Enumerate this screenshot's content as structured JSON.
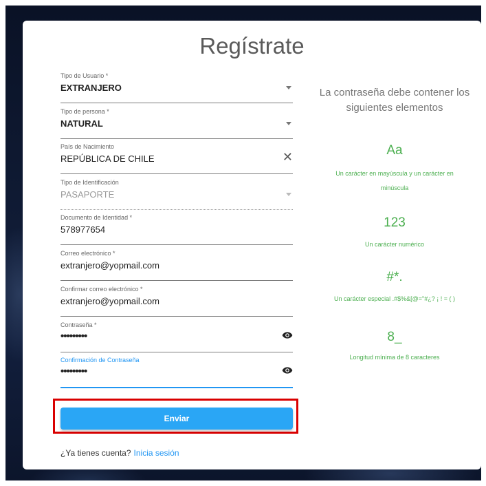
{
  "form": {
    "title": "Regístrate",
    "fields": [
      {
        "label": "Tipo de Usuario *",
        "value": "EXTRANJERO"
      },
      {
        "label": "Tipo de persona *",
        "value": "NATURAL"
      },
      {
        "label": "País de Nacimiento",
        "value": "REPÚBLICA DE CHILE"
      },
      {
        "label": "Tipo de Identificación",
        "value": "PASAPORTE"
      },
      {
        "label": "Documento de Identidad *",
        "value": "578977654"
      },
      {
        "label": "Correo electrónico *",
        "value": "extranjero@yopmail.com"
      },
      {
        "label": "Confirmar correo electrónico *",
        "value": "extranjero@yopmail.com"
      },
      {
        "label": "Contraseña *",
        "value": "•••••••••"
      },
      {
        "label": "Confirmación de Contraseña",
        "value": "•••••••••"
      }
    ],
    "submit_label": "Enviar",
    "have_account_text": "¿Ya tienes cuenta?",
    "login_link": "Inicia sesión"
  },
  "password_rules": {
    "heading": "La contraseña debe contener los siguientes elementos",
    "items": [
      {
        "symbol": "Aa",
        "description": "Un carácter en mayúscula y un carácter en minúscula"
      },
      {
        "symbol": "123",
        "description": "Un carácter numérico"
      },
      {
        "symbol": "#*.",
        "description": "Un carácter especial .#$%&[@=\"#¿? ¡ ! = ( )"
      },
      {
        "symbol": "8_",
        "description": "Longitud mínima de 8 caracteres"
      }
    ],
    "color": "#4caf50"
  },
  "colors": {
    "accent": "#2196f3",
    "button": "#2aa6f5",
    "highlight": "#d90000"
  }
}
